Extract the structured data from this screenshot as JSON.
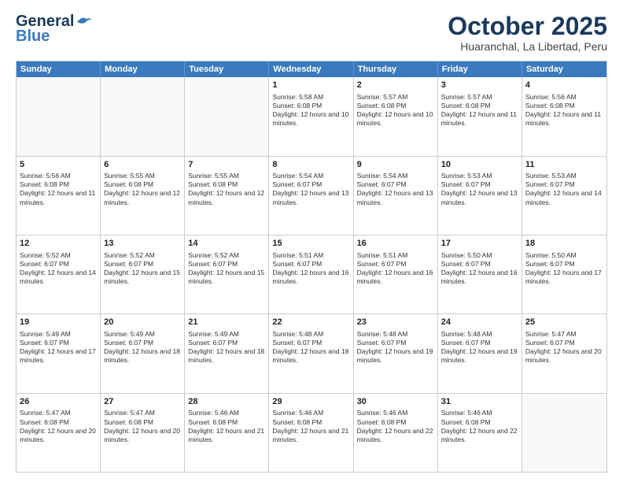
{
  "header": {
    "logo_line1": "General",
    "logo_line2": "Blue",
    "month": "October 2025",
    "location": "Huaranchal, La Libertad, Peru"
  },
  "weekdays": [
    "Sunday",
    "Monday",
    "Tuesday",
    "Wednesday",
    "Thursday",
    "Friday",
    "Saturday"
  ],
  "rows": [
    [
      {
        "day": "",
        "text": ""
      },
      {
        "day": "",
        "text": ""
      },
      {
        "day": "",
        "text": ""
      },
      {
        "day": "1",
        "text": "Sunrise: 5:58 AM\nSunset: 6:08 PM\nDaylight: 12 hours and 10 minutes."
      },
      {
        "day": "2",
        "text": "Sunrise: 5:57 AM\nSunset: 6:08 PM\nDaylight: 12 hours and 10 minutes."
      },
      {
        "day": "3",
        "text": "Sunrise: 5:57 AM\nSunset: 6:08 PM\nDaylight: 12 hours and 11 minutes."
      },
      {
        "day": "4",
        "text": "Sunrise: 5:56 AM\nSunset: 6:08 PM\nDaylight: 12 hours and 11 minutes."
      }
    ],
    [
      {
        "day": "5",
        "text": "Sunrise: 5:56 AM\nSunset: 6:08 PM\nDaylight: 12 hours and 11 minutes."
      },
      {
        "day": "6",
        "text": "Sunrise: 5:55 AM\nSunset: 6:08 PM\nDaylight: 12 hours and 12 minutes."
      },
      {
        "day": "7",
        "text": "Sunrise: 5:55 AM\nSunset: 6:08 PM\nDaylight: 12 hours and 12 minutes."
      },
      {
        "day": "8",
        "text": "Sunrise: 5:54 AM\nSunset: 6:07 PM\nDaylight: 12 hours and 13 minutes."
      },
      {
        "day": "9",
        "text": "Sunrise: 5:54 AM\nSunset: 6:07 PM\nDaylight: 12 hours and 13 minutes."
      },
      {
        "day": "10",
        "text": "Sunrise: 5:53 AM\nSunset: 6:07 PM\nDaylight: 12 hours and 13 minutes."
      },
      {
        "day": "11",
        "text": "Sunrise: 5:53 AM\nSunset: 6:07 PM\nDaylight: 12 hours and 14 minutes."
      }
    ],
    [
      {
        "day": "12",
        "text": "Sunrise: 5:52 AM\nSunset: 6:07 PM\nDaylight: 12 hours and 14 minutes."
      },
      {
        "day": "13",
        "text": "Sunrise: 5:52 AM\nSunset: 6:07 PM\nDaylight: 12 hours and 15 minutes."
      },
      {
        "day": "14",
        "text": "Sunrise: 5:52 AM\nSunset: 6:07 PM\nDaylight: 12 hours and 15 minutes."
      },
      {
        "day": "15",
        "text": "Sunrise: 5:51 AM\nSunset: 6:07 PM\nDaylight: 12 hours and 16 minutes."
      },
      {
        "day": "16",
        "text": "Sunrise: 5:51 AM\nSunset: 6:07 PM\nDaylight: 12 hours and 16 minutes."
      },
      {
        "day": "17",
        "text": "Sunrise: 5:50 AM\nSunset: 6:07 PM\nDaylight: 12 hours and 16 minutes."
      },
      {
        "day": "18",
        "text": "Sunrise: 5:50 AM\nSunset: 6:07 PM\nDaylight: 12 hours and 17 minutes."
      }
    ],
    [
      {
        "day": "19",
        "text": "Sunrise: 5:49 AM\nSunset: 6:07 PM\nDaylight: 12 hours and 17 minutes."
      },
      {
        "day": "20",
        "text": "Sunrise: 5:49 AM\nSunset: 6:07 PM\nDaylight: 12 hours and 18 minutes."
      },
      {
        "day": "21",
        "text": "Sunrise: 5:49 AM\nSunset: 6:07 PM\nDaylight: 12 hours and 18 minutes."
      },
      {
        "day": "22",
        "text": "Sunrise: 5:48 AM\nSunset: 6:07 PM\nDaylight: 12 hours and 18 minutes."
      },
      {
        "day": "23",
        "text": "Sunrise: 5:48 AM\nSunset: 6:07 PM\nDaylight: 12 hours and 19 minutes."
      },
      {
        "day": "24",
        "text": "Sunrise: 5:48 AM\nSunset: 6:07 PM\nDaylight: 12 hours and 19 minutes."
      },
      {
        "day": "25",
        "text": "Sunrise: 5:47 AM\nSunset: 6:07 PM\nDaylight: 12 hours and 20 minutes."
      }
    ],
    [
      {
        "day": "26",
        "text": "Sunrise: 5:47 AM\nSunset: 6:08 PM\nDaylight: 12 hours and 20 minutes."
      },
      {
        "day": "27",
        "text": "Sunrise: 5:47 AM\nSunset: 6:08 PM\nDaylight: 12 hours and 20 minutes."
      },
      {
        "day": "28",
        "text": "Sunrise: 5:46 AM\nSunset: 6:08 PM\nDaylight: 12 hours and 21 minutes."
      },
      {
        "day": "29",
        "text": "Sunrise: 5:46 AM\nSunset: 6:08 PM\nDaylight: 12 hours and 21 minutes."
      },
      {
        "day": "30",
        "text": "Sunrise: 5:46 AM\nSunset: 6:08 PM\nDaylight: 12 hours and 22 minutes."
      },
      {
        "day": "31",
        "text": "Sunrise: 5:46 AM\nSunset: 6:08 PM\nDaylight: 12 hours and 22 minutes."
      },
      {
        "day": "",
        "text": ""
      }
    ]
  ]
}
